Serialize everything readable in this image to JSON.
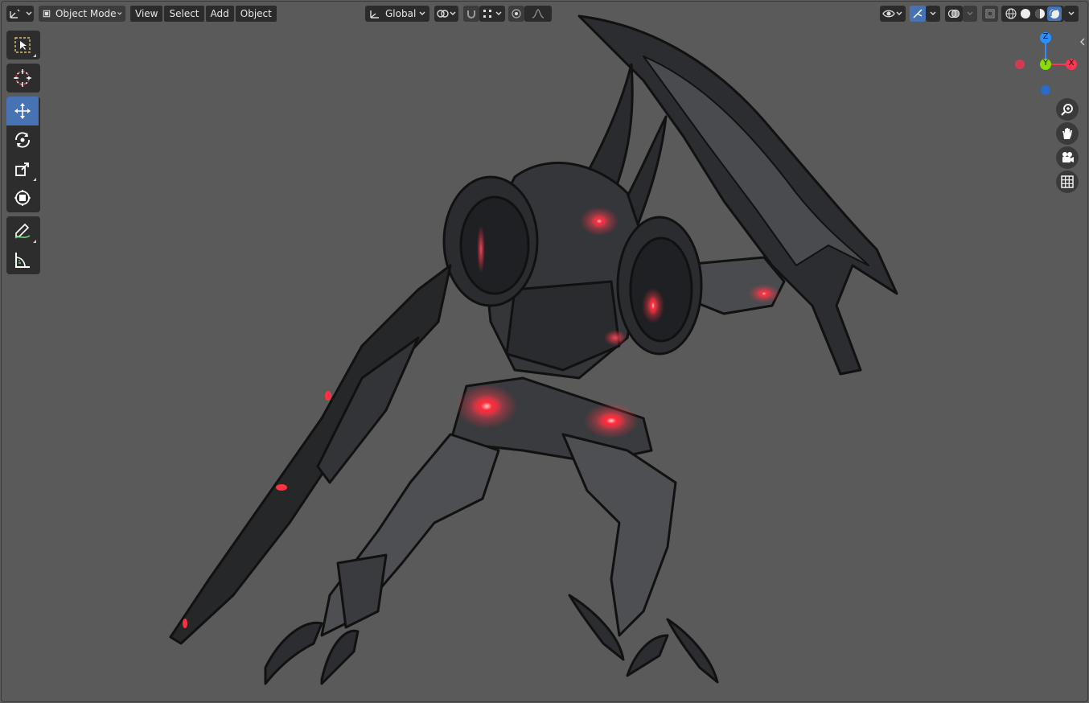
{
  "header": {
    "mode_label": "Object Mode",
    "menus": [
      {
        "id": "view",
        "label": "View"
      },
      {
        "id": "select",
        "label": "Select"
      },
      {
        "id": "add",
        "label": "Add"
      },
      {
        "id": "object",
        "label": "Object"
      }
    ],
    "transform_orientation": "Global"
  },
  "gizmo": {
    "z_label": "Z",
    "y_label": "Y",
    "x_label": "X",
    "colors": {
      "x": "#ff3352",
      "y": "#8bdc00",
      "z": "#2890ff"
    }
  },
  "toolbar": {
    "tools": [
      "select-box",
      "cursor",
      "move",
      "rotate",
      "scale",
      "transform",
      "annotate",
      "measure"
    ],
    "active_tool": "move"
  },
  "navigation": {
    "buttons": [
      "zoom",
      "pan",
      "camera",
      "perspective-ortho"
    ]
  },
  "shading": {
    "modes": [
      "wireframe",
      "solid",
      "material-preview",
      "rendered"
    ],
    "active_mode": "rendered"
  },
  "colors": {
    "accent": "#4772b3",
    "viewport_bg": "#5a5a5a",
    "glow_red": "#ff2a3a"
  }
}
